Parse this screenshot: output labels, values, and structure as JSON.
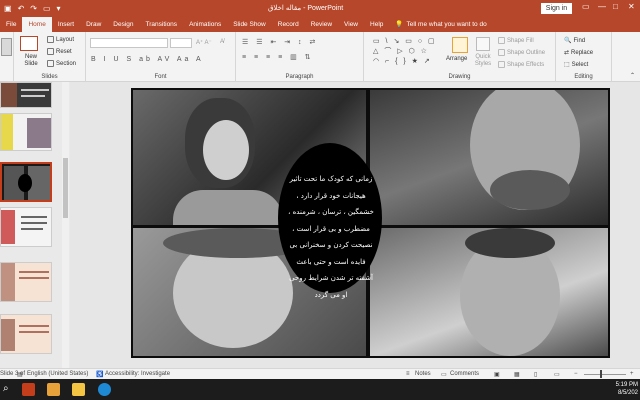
{
  "window": {
    "title": "مقاله اخلاق - PowerPoint",
    "sign_in": "Sign in"
  },
  "tabs": [
    {
      "label": "File",
      "active": false
    },
    {
      "label": "Home",
      "active": true
    },
    {
      "label": "Insert",
      "active": false
    },
    {
      "label": "Draw",
      "active": false
    },
    {
      "label": "Design",
      "active": false
    },
    {
      "label": "Transitions",
      "active": false
    },
    {
      "label": "Animations",
      "active": false
    },
    {
      "label": "Slide Show",
      "active": false
    },
    {
      "label": "Record",
      "active": false
    },
    {
      "label": "Review",
      "active": false
    },
    {
      "label": "View",
      "active": false
    },
    {
      "label": "Help",
      "active": false
    }
  ],
  "tell_me": "Tell me what you want to do",
  "ribbon": {
    "slides": {
      "group_label": "Slides",
      "new_slide": "New Slide",
      "layout": "Layout",
      "reset": "Reset",
      "section": "Section"
    },
    "font": {
      "group_label": "Font"
    },
    "paragraph": {
      "group_label": "Paragraph"
    },
    "drawing": {
      "group_label": "Drawing",
      "arrange": "Arrange",
      "quick_styles": "Quick Styles",
      "shape_fill": "Shape Fill",
      "shape_outline": "Shape Outline",
      "shape_effects": "Shape Effects"
    },
    "editing": {
      "group_label": "Editing",
      "find": "Find",
      "replace": "Replace",
      "select": "Select"
    }
  },
  "slide": {
    "text": "زمانی که کودک ما تحت تاثیر هیجانات خود قرار دارد ، خشمگین ، ترسان ، شرمنده ، مضطرب و بی قرار است ، نصیحت کردن و سخنرانی بی فایده است و حتی باعث آشفته تر شدن شرایط روحی او می گردد"
  },
  "thumbnails": [
    {
      "num": ""
    },
    {
      "num": ""
    },
    {
      "num": "3"
    },
    {
      "num": ""
    },
    {
      "num": ""
    },
    {
      "num": ""
    }
  ],
  "status_bar": {
    "slide_info": "Slide 3 of",
    "language": "English (United States)",
    "accessibility": "Accessibility: Investigate",
    "notes": "Notes",
    "comments": "Comments"
  },
  "taskbar": {
    "time": "5:19 PM",
    "date": "8/5/202"
  },
  "colors": {
    "accent": "#b7472a",
    "ribbon_bg": "#f3f3f3",
    "taskbar_bg": "#1c1c1c"
  }
}
